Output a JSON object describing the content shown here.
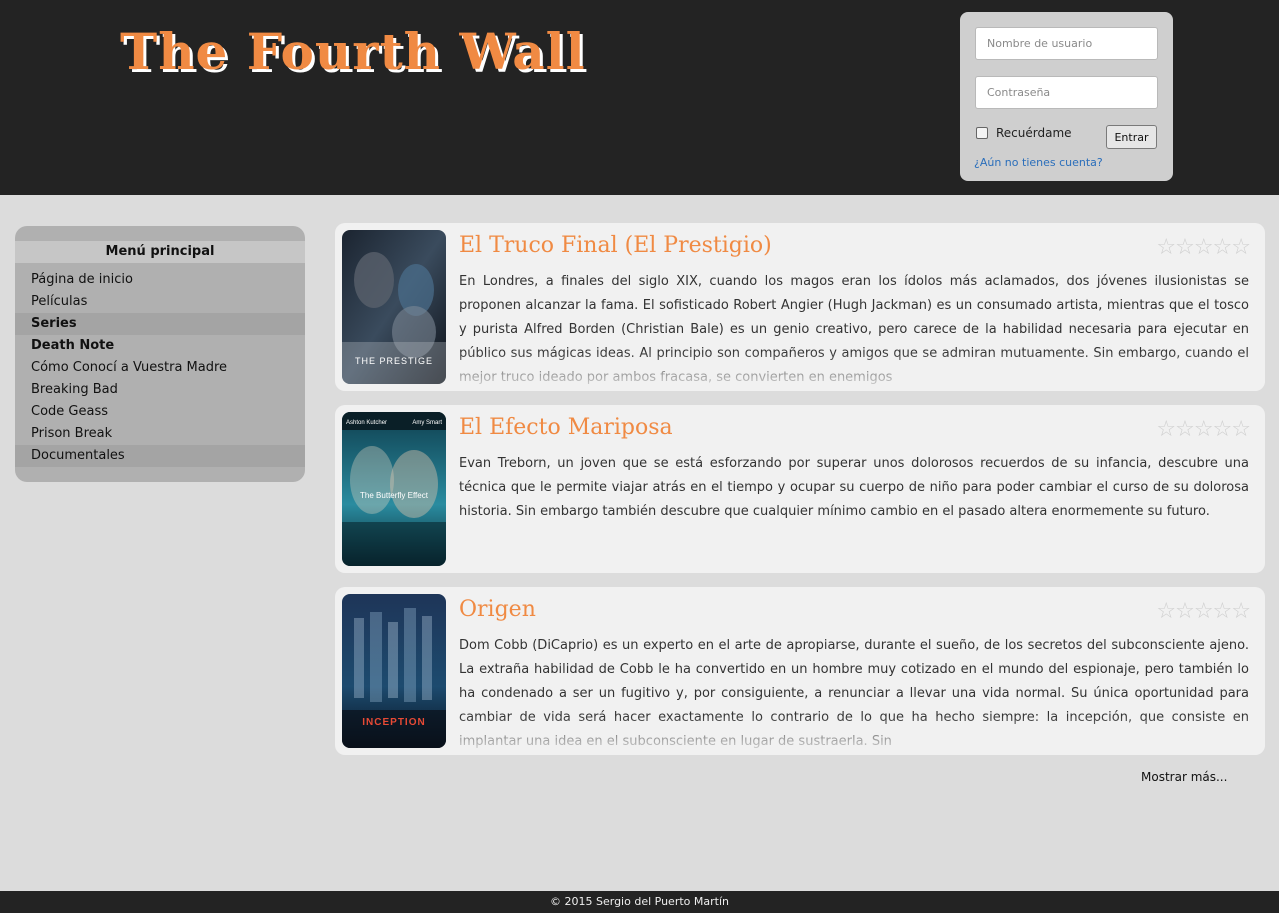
{
  "header": {
    "site_title": "The Fourth Wall"
  },
  "login": {
    "username_placeholder": "Nombre de usuario",
    "password_placeholder": "Contraseña",
    "remember_label": "Recuérdame",
    "submit_label": "Entrar",
    "register_link": "¿Aún no tienes cuenta?"
  },
  "sidebar": {
    "title": "Menú principal",
    "items": [
      "Página de inicio",
      "Películas",
      "Series",
      "Death Note",
      "Cómo Conocí a Vuestra Madre",
      "Breaking Bad",
      "Code Geass",
      "Prison Break",
      "Documentales"
    ]
  },
  "movies": [
    {
      "title": "El Truco Final (El Prestigio)",
      "poster_caption": "THE PRESTIGE",
      "rating_stars": "☆☆☆☆☆",
      "description": "En Londres, a finales del siglo XIX, cuando los magos eran los ídolos más aclamados, dos jóvenes ilusionistas se proponen alcanzar la fama. El sofisticado Robert Angier (Hugh Jackman) es un consumado artista, mientras que el tosco y purista Alfred Borden (Christian Bale) es un genio creativo, pero carece de la habilidad necesaria para ejecutar en público sus mágicas ideas. Al principio son compañeros y amigos que se admiran mutuamente. Sin embargo, cuando el mejor truco ideado por ambos fracasa, se convierten en enemigos"
    },
    {
      "title": "El Efecto Mariposa",
      "poster_top_left": "Ashton Kutcher",
      "poster_top_right": "Amy Smart",
      "poster_caption": "The Butterfly Effect",
      "rating_stars": "☆☆☆☆☆",
      "description": "Evan Treborn, un joven que se está esforzando por superar unos dolorosos recuerdos de su infancia, descubre una técnica que le permite viajar atrás en el tiempo y ocupar su cuerpo de niño para poder cambiar el curso de su dolorosa historia. Sin embargo también descubre que cualquier mínimo cambio en el pasado altera enormemente su futuro."
    },
    {
      "title": "Origen",
      "poster_caption": "INCEPTION",
      "rating_stars": "☆☆☆☆☆",
      "description": "Dom Cobb (DiCaprio) es un experto en el arte de apropiarse, durante el sueño, de los secretos del subconsciente ajeno. La extraña habilidad de Cobb le ha convertido en un hombre muy cotizado en el mundo del espionaje, pero también lo ha condenado a ser un fugitivo y, por consiguiente, a renunciar a llevar una vida normal. Su única oportunidad para cambiar de vida será hacer exactamente lo contrario de lo que ha hecho siempre: la incepción, que consiste en implantar una idea en el subconsciente en lugar de sustraerla. Sin"
    }
  ],
  "more_link": "Mostrar más...",
  "footer": "© 2015 Sergio del Puerto Martín",
  "colors": {
    "accent": "#f08a43",
    "header_bg": "#232323",
    "link": "#2a6ebb"
  }
}
